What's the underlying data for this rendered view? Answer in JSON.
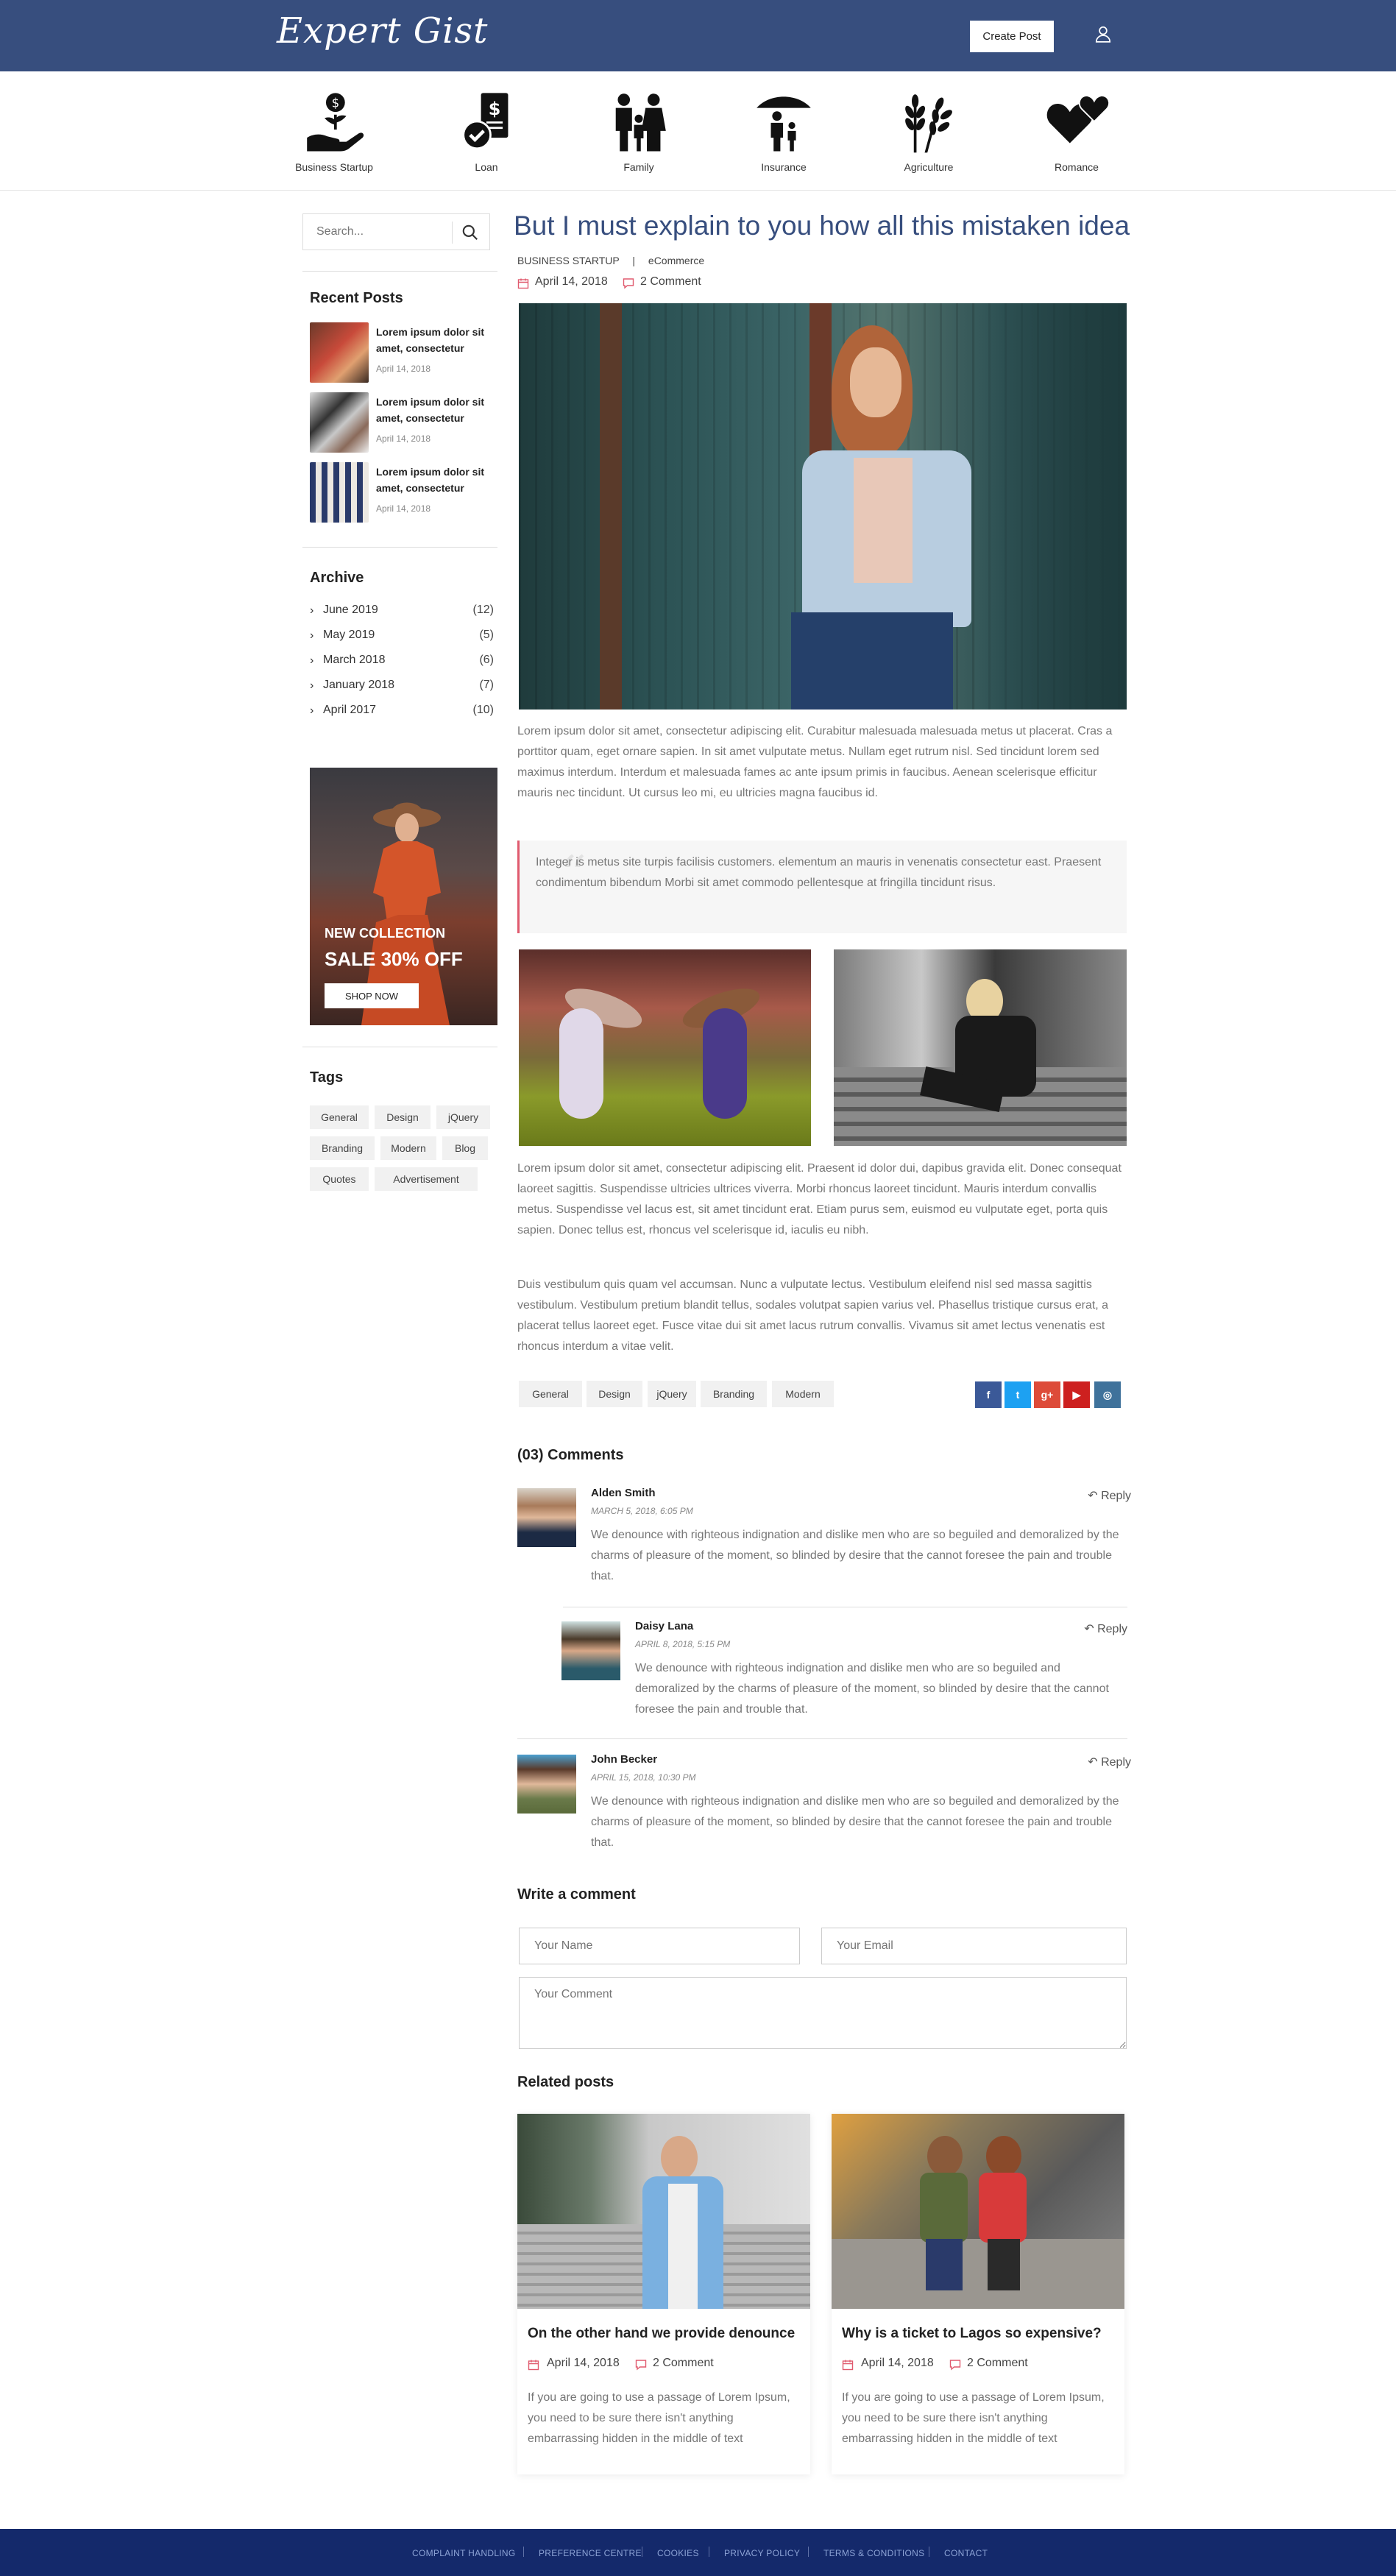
{
  "header": {
    "logo": "Expert Gist",
    "create_post": "Create Post",
    "bg_color": "#374e7e"
  },
  "categories": [
    {
      "label": "Business Startup",
      "icon": "money-plant-hand-icon"
    },
    {
      "label": "Loan",
      "icon": "loan-document-icon"
    },
    {
      "label": "Family",
      "icon": "family-icon"
    },
    {
      "label": "Insurance",
      "icon": "umbrella-family-icon"
    },
    {
      "label": "Agriculture",
      "icon": "wheat-icon"
    },
    {
      "label": "Romance",
      "icon": "hearts-icon"
    }
  ],
  "sidebar": {
    "search_placeholder": "Search...",
    "recent_title": "Recent Posts",
    "recent": [
      {
        "title": "Lorem ipsum dolor sit amet, consectetur",
        "date": "April 14, 2018"
      },
      {
        "title": "Lorem ipsum dolor sit amet, consectetur",
        "date": "April 14, 2018"
      },
      {
        "title": "Lorem ipsum dolor sit amet, consectetur",
        "date": "April 14, 2018"
      }
    ],
    "archive_title": "Archive",
    "archive": [
      {
        "label": "June 2019",
        "count": "(12)"
      },
      {
        "label": "May 2019",
        "count": "(5)"
      },
      {
        "label": "March 2018",
        "count": "(6)"
      },
      {
        "label": "January 2018",
        "count": "(7)"
      },
      {
        "label": "April 2017",
        "count": "(10)"
      }
    ],
    "promo": {
      "line1": "NEW COLLECTION",
      "line2": "SALE 30% OFF",
      "button": "SHOP NOW"
    },
    "tags_title": "Tags",
    "tags": [
      "General",
      "Design",
      "jQuery",
      "Branding",
      "Modern",
      "Blog",
      "Quotes",
      "Advertisement"
    ]
  },
  "post": {
    "title": "But I must explain to you how all this mistaken idea",
    "category": "BUSINESS STARTUP",
    "separator": "|",
    "subcategory": "eCommerce",
    "date": "April 14, 2018",
    "comments": "2 Comment",
    "para1": "Lorem ipsum dolor sit amet, consectetur adipiscing elit. Curabitur malesuada malesuada metus ut placerat. Cras a porttitor quam, eget ornare sapien. In sit amet vulputate metus. Nullam eget rutrum nisl. Sed tincidunt lorem sed maximus interdum. Interdum et malesuada fames ac ante ipsum primis in faucibus. Aenean scelerisque efficitur mauris nec tincidunt. Ut cursus leo mi, eu ultricies magna faucibus id.",
    "quote": "Integer is metus site turpis facilisis customers. elementum an mauris in venenatis consectetur east. Praesent condimentum bibendum Morbi sit amet commodo pellentesque at fringilla tincidunt risus.",
    "para2": "Lorem ipsum dolor sit amet, consectetur adipiscing elit. Praesent id dolor dui, dapibus gravida elit. Donec consequat laoreet sagittis. Suspendisse ultricies ultrices viverra. Morbi rhoncus laoreet tincidunt. Mauris interdum convallis metus. Suspendisse vel lacus est, sit amet tincidunt erat. Etiam purus sem, euismod eu vulputate eget, porta quis sapien. Donec tellus est, rhoncus vel scelerisque id, iaculis eu nibh.",
    "para3": "Duis vestibulum quis quam vel accumsan. Nunc a vulputate lectus. Vestibulum eleifend nisl sed massa sagittis vestibulum. Vestibulum pretium blandit tellus, sodales volutpat sapien varius vel. Phasellus tristique cursus erat, a placerat tellus laoreet eget. Fusce vitae dui sit amet lacus rutrum convallis. Vivamus sit amet lectus venenatis est rhoncus interdum a vitae velit.",
    "tags": [
      "General",
      "Design",
      "jQuery",
      "Branding",
      "Modern"
    ],
    "social": [
      {
        "icon": "facebook-icon",
        "glyph": "f",
        "color": "#3b5998"
      },
      {
        "icon": "twitter-icon",
        "glyph": "t",
        "color": "#1da1f2"
      },
      {
        "icon": "google-plus-icon",
        "glyph": "g+",
        "color": "#dd4b39"
      },
      {
        "icon": "youtube-icon",
        "glyph": "▶",
        "color": "#cd201f"
      },
      {
        "icon": "instagram-icon",
        "glyph": "◎",
        "color": "#3f729b"
      }
    ]
  },
  "comments": {
    "title": "(03) Comments",
    "reply_label": "Reply",
    "items": [
      {
        "name": "Alden Smith",
        "date": "MARCH 5, 2018, 6:05 PM",
        "text": "We denounce with righteous indignation and dislike men who are so beguiled and demoralized by the charms of pleasure of the moment, so blinded by desire that the cannot foresee the pain and trouble that."
      },
      {
        "name": "Daisy Lana",
        "date": "APRIL 8, 2018, 5:15 PM",
        "text": "We denounce with righteous indignation and dislike men who are so beguiled and demoralized by the charms of pleasure of the moment, so blinded by desire that the cannot foresee the pain and trouble that."
      },
      {
        "name": "John Becker",
        "date": "APRIL 15, 2018, 10:30 PM",
        "text": "We denounce with righteous indignation and dislike men who are so beguiled and demoralized by the charms of pleasure of the moment, so blinded by desire that the cannot foresee the pain and trouble that."
      }
    ]
  },
  "form": {
    "title": "Write a comment",
    "name_placeholder": "Your Name",
    "email_placeholder": "Your Email",
    "comment_placeholder": "Your Comment"
  },
  "related": {
    "title": "Related posts",
    "items": [
      {
        "title": "On the other hand we provide denounce",
        "date": "April 14, 2018",
        "comments": "2 Comment",
        "text": "If you are going to use a passage of Lorem Ipsum, you need to be sure there isn't anything embarrassing hidden in the middle of text"
      },
      {
        "title": "Why is a ticket to Lagos so expensive?",
        "date": "April 14, 2018",
        "comments": "2 Comment",
        "text": "If you are going to use a passage of Lorem Ipsum, you need to be sure there isn't anything embarrassing hidden in the middle of text"
      }
    ]
  },
  "footer": {
    "links": [
      "COMPLAINT HANDLING",
      "PREFERENCE CENTRE",
      "COOKIES",
      "PRIVACY POLICY",
      "TERMS & CONDITIONS",
      "CONTACT"
    ]
  }
}
